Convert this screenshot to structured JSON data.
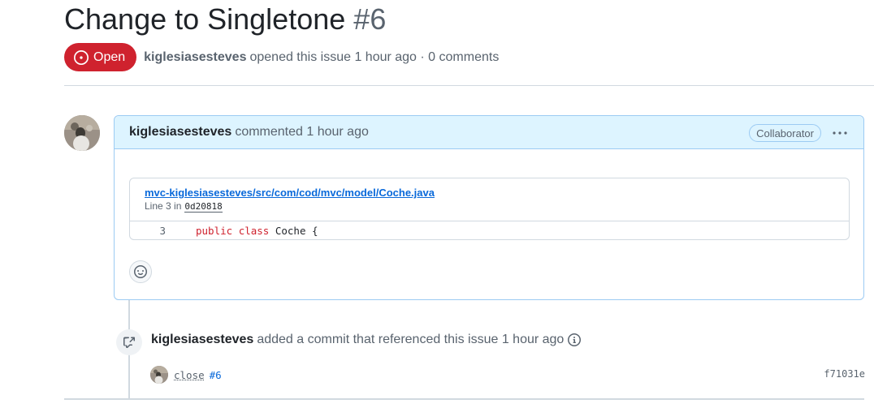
{
  "issue": {
    "title": "Change to Singletone",
    "number": "#6",
    "state": "Open",
    "author": "kiglesiasesteves",
    "meta_text": "opened this issue 1 hour ago · 0 comments"
  },
  "comment": {
    "author": "kiglesiasesteves",
    "action": "commented 1 hour ago",
    "role_badge": "Collaborator",
    "code_ref": {
      "file_path": "mvc-kiglesiasesteves/src/com/cod/mvc/model/Coche.java",
      "line_prefix": "Line 3 in",
      "commit_sha": "0d20818",
      "line_number": "3",
      "code_keyword1": "public",
      "code_keyword2": "class",
      "code_rest": "Coche {"
    }
  },
  "event": {
    "author": "kiglesiasesteves",
    "text": "added a commit that referenced this issue 1 hour ago",
    "commit": {
      "message": "close",
      "ref": "#6",
      "sha": "f71031e"
    }
  },
  "colors": {
    "open_red": "#cf222e",
    "link_blue": "#0969da",
    "comment_header_bg": "#ddf4ff",
    "comment_border": "#9ccbf3"
  }
}
